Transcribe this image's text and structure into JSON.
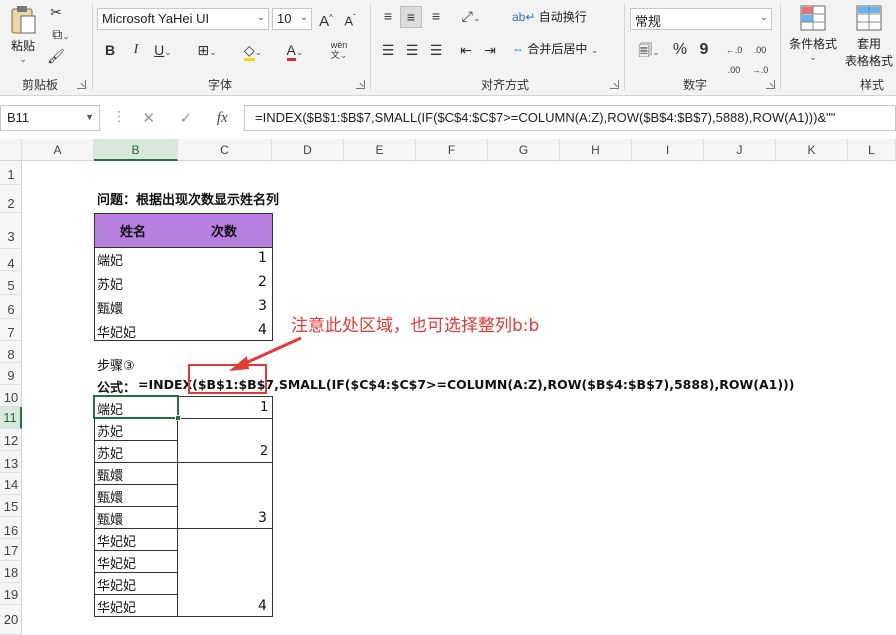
{
  "ribbon": {
    "clipboard": {
      "paste_label": "粘贴",
      "group_label": "剪贴板"
    },
    "font": {
      "font_name": "Microsoft YaHei UI",
      "font_size": "10",
      "bold": "B",
      "italic": "I",
      "underline": "U",
      "group_label": "字体"
    },
    "alignment": {
      "wrap_text": "自动换行",
      "merge_center": "合并后居中",
      "group_label": "对齐方式"
    },
    "number": {
      "format": "常规",
      "percent": "%",
      "comma": "9",
      "group_label": "数字"
    },
    "styles": {
      "conditional": "条件格式",
      "table_format_1": "套用",
      "table_format_2": "表格格式",
      "group_label": "样式"
    }
  },
  "formula_bar": {
    "name_box": "B11",
    "cancel": "✕",
    "enter": "✓",
    "fx": "fx",
    "formula": "=INDEX($B$1:$B$7,SMALL(IF($C$4:$C$7>=COLUMN(A:Z),ROW($B$4:$B$7),5888),ROW(A1)))&\"\""
  },
  "columns": [
    "A",
    "B",
    "C",
    "D",
    "E",
    "F",
    "G",
    "H",
    "I",
    "J",
    "K",
    "L"
  ],
  "rows": [
    "1",
    "2",
    "3",
    "4",
    "5",
    "6",
    "7",
    "8",
    "9",
    "10",
    "11",
    "12",
    "13",
    "14",
    "15",
    "16",
    "17",
    "18",
    "19",
    "20"
  ],
  "sheet": {
    "title": "问题：根据出现次数显示姓名列",
    "header_name": "姓名",
    "header_count": "次数",
    "source_rows": [
      {
        "name": "端妃",
        "count": "1"
      },
      {
        "name": "苏妃",
        "count": "2"
      },
      {
        "name": "甄嬛",
        "count": "3"
      },
      {
        "name": "华妃妃",
        "count": "4"
      }
    ],
    "step": "步骤③",
    "formula_label": "公式：",
    "formula_text": "=INDEX($B$1:$B$7,SMALL(IF($C$4:$C$7>=COLUMN(A:Z),ROW($B$4:$B$7),5888),ROW(A1)))",
    "result_names": [
      "端妃",
      "苏妃",
      "苏妃",
      "甄嬛",
      "甄嬛",
      "甄嬛",
      "华妃妃",
      "华妃妃",
      "华妃妃",
      "华妃妃"
    ],
    "result_counts": [
      "1",
      "2",
      "3",
      "4"
    ],
    "annotation": "注意此处区域，也可选择整列b:b"
  },
  "colors": {
    "header_fill": "#b67fe0",
    "annotation": "#e53935",
    "selection": "#217346"
  }
}
